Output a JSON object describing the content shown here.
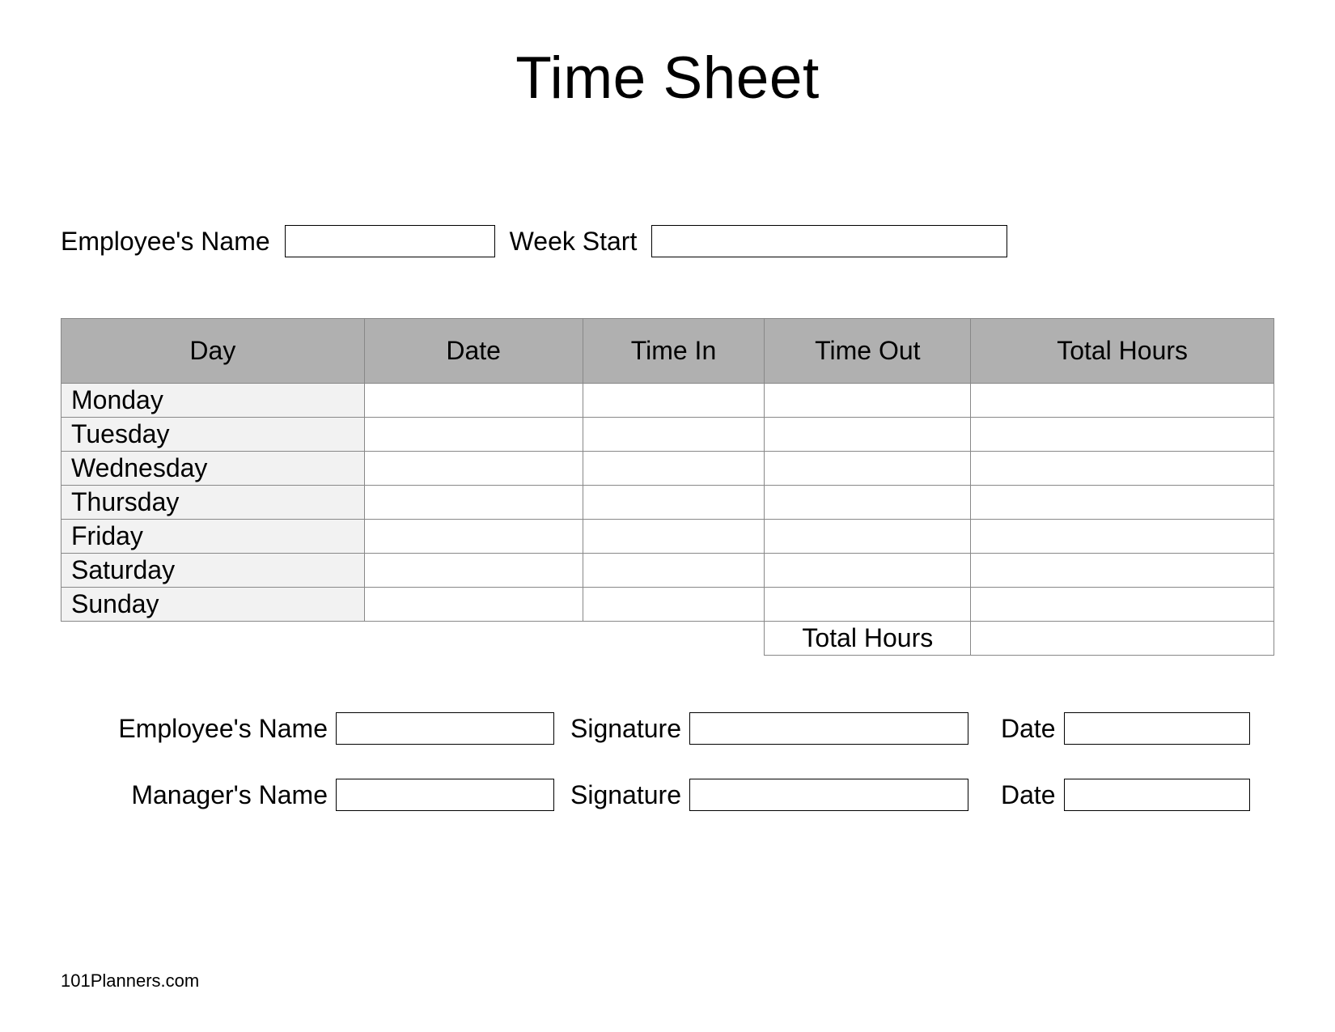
{
  "title": "Time Sheet",
  "top_fields": {
    "employee_label": "Employee's Name",
    "week_start_label": "Week Start"
  },
  "table": {
    "headers": {
      "day": "Day",
      "date": "Date",
      "time_in": "Time In",
      "time_out": "Time Out",
      "total_hours": "Total Hours"
    },
    "rows": [
      {
        "day": "Monday",
        "date": "",
        "time_in": "",
        "time_out": "",
        "total_hours": ""
      },
      {
        "day": "Tuesday",
        "date": "",
        "time_in": "",
        "time_out": "",
        "total_hours": ""
      },
      {
        "day": "Wednesday",
        "date": "",
        "time_in": "",
        "time_out": "",
        "total_hours": ""
      },
      {
        "day": "Thursday",
        "date": "",
        "time_in": "",
        "time_out": "",
        "total_hours": ""
      },
      {
        "day": "Friday",
        "date": "",
        "time_in": "",
        "time_out": "",
        "total_hours": ""
      },
      {
        "day": "Saturday",
        "date": "",
        "time_in": "",
        "time_out": "",
        "total_hours": ""
      },
      {
        "day": "Sunday",
        "date": "",
        "time_in": "",
        "time_out": "",
        "total_hours": ""
      }
    ],
    "total_label": "Total Hours",
    "total_value": ""
  },
  "signature_block": {
    "employee": {
      "name_label": "Employee's Name",
      "signature_label": "Signature",
      "date_label": "Date"
    },
    "manager": {
      "name_label": "Manager's Name",
      "signature_label": "Signature",
      "date_label": "Date"
    }
  },
  "footer": "101Planners.com"
}
